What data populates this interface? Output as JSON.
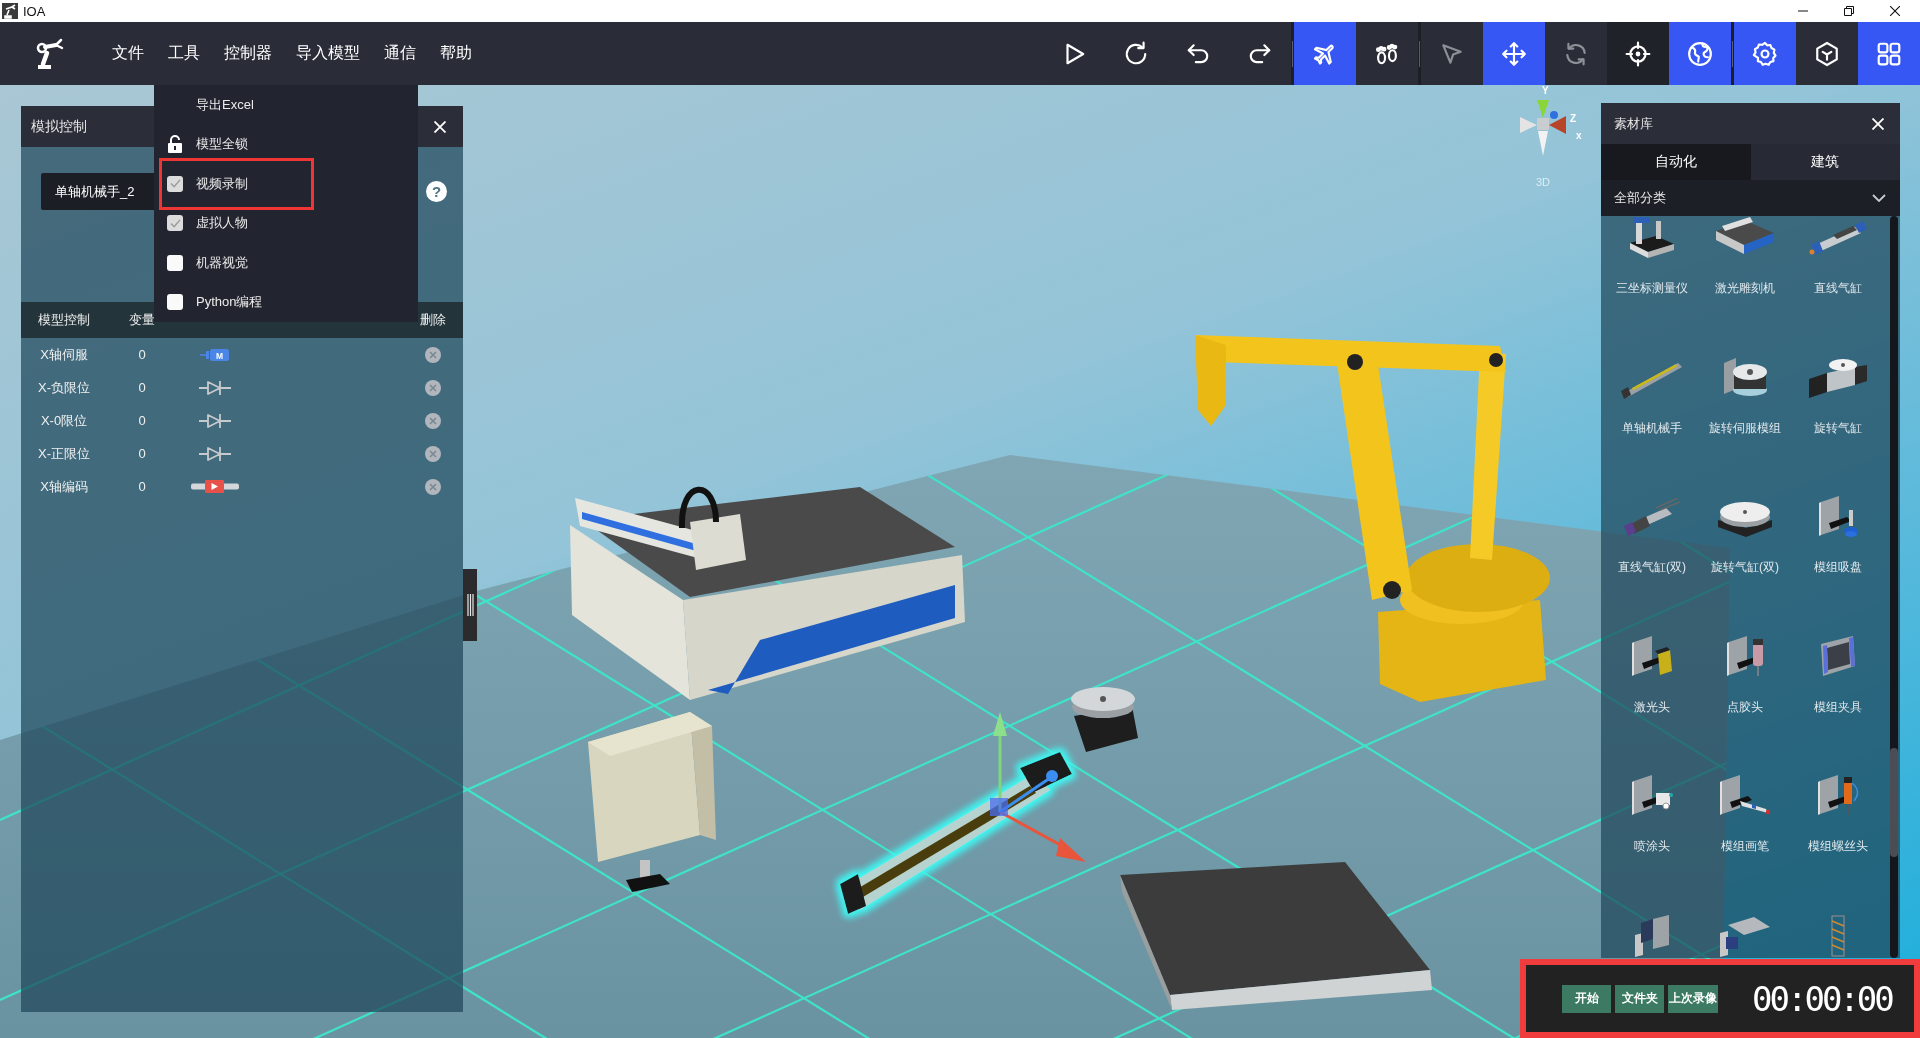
{
  "window": {
    "title": "IOA",
    "controls": [
      {
        "kind": "minimize"
      },
      {
        "kind": "restore"
      },
      {
        "kind": "close"
      }
    ]
  },
  "menu_bar": {
    "items": [
      {
        "label": "文件"
      },
      {
        "label": "工具",
        "dropdown": [
          {
            "kind": "plain",
            "label": "导出Excel",
            "highlighted": false
          },
          {
            "kind": "lock",
            "label": "模型全锁",
            "locked": false,
            "highlighted": false
          },
          {
            "kind": "checkbox",
            "label": "视频录制",
            "checked": true,
            "highlighted": true
          },
          {
            "kind": "checkbox",
            "label": "虚拟人物",
            "checked": true,
            "highlighted": false
          },
          {
            "kind": "checkbox",
            "label": "机器视觉",
            "checked": false,
            "highlighted": false
          },
          {
            "kind": "checkbox",
            "label": "Python编程",
            "checked": false,
            "highlighted": false
          }
        ]
      },
      {
        "label": "控制器"
      },
      {
        "label": "导入模型"
      },
      {
        "label": "通信"
      },
      {
        "label": "帮助"
      }
    ]
  },
  "toolbar": {
    "groups": [
      {
        "buttons": [
          {
            "kind": "play",
            "selected": false,
            "disabled": false,
            "hovered": false
          },
          {
            "kind": "refresh",
            "selected": false,
            "disabled": false,
            "hovered": false
          },
          {
            "kind": "undo",
            "selected": false,
            "disabled": false,
            "hovered": false
          },
          {
            "kind": "redo",
            "selected": false,
            "disabled": false,
            "hovered": false
          }
        ]
      },
      {
        "buttons": [
          {
            "kind": "airplane",
            "selected": true,
            "disabled": false,
            "hovered": false
          },
          {
            "kind": "footprints",
            "selected": false,
            "disabled": false,
            "hovered": false
          }
        ]
      },
      {
        "buttons": [
          {
            "kind": "cursor",
            "selected": false,
            "disabled": true,
            "hovered": false
          },
          {
            "kind": "move",
            "selected": true,
            "disabled": false,
            "hovered": false
          },
          {
            "kind": "sync",
            "selected": false,
            "disabled": true,
            "hovered": false
          },
          {
            "kind": "crosshair",
            "selected": false,
            "disabled": false,
            "hovered": true
          },
          {
            "kind": "globe",
            "selected": true,
            "disabled": false,
            "hovered": false
          }
        ]
      },
      {
        "buttons": [
          {
            "kind": "settings",
            "selected": true,
            "disabled": false,
            "hovered": false
          },
          {
            "kind": "cube",
            "selected": false,
            "disabled": false,
            "hovered": false
          },
          {
            "kind": "grid",
            "selected": true,
            "disabled": false,
            "hovered": false
          }
        ]
      }
    ]
  },
  "simulation_panel": {
    "title": "模拟控制",
    "model_select": {
      "value": "单轴机械手_2"
    },
    "help": "?",
    "columns": [
      {
        "kind": "name",
        "label": "模型控制"
      },
      {
        "kind": "value",
        "label": "变量"
      },
      {
        "kind": "delete",
        "label": "删除"
      }
    ],
    "rows": [
      {
        "name": "X轴伺服",
        "value": "0",
        "control": {
          "kind": "motor",
          "label": "M"
        }
      },
      {
        "name": "X-负限位",
        "value": "0",
        "control": {
          "kind": "limit-switch"
        }
      },
      {
        "name": "X-0限位",
        "value": "0",
        "control": {
          "kind": "limit-switch"
        }
      },
      {
        "name": "X-正限位",
        "value": "0",
        "control": {
          "kind": "limit-switch"
        }
      },
      {
        "name": "X轴编码",
        "value": "0",
        "control": {
          "kind": "encoder"
        }
      }
    ]
  },
  "library_panel": {
    "title": "素材库",
    "tabs": [
      {
        "label": "自动化",
        "selected": true
      },
      {
        "label": "建筑",
        "selected": false
      }
    ],
    "category": {
      "value": "全部分类"
    },
    "items": [
      {
        "kind": "cmm",
        "label": "三坐标测量仪"
      },
      {
        "kind": "engraver",
        "label": "激光雕刻机"
      },
      {
        "kind": "cylinder",
        "label": "直线气缸"
      },
      {
        "kind": "rail",
        "label": "单轴机械手"
      },
      {
        "kind": "rotary-servo",
        "label": "旋转伺服模组"
      },
      {
        "kind": "rotary-cylinder",
        "label": "旋转气缸"
      },
      {
        "kind": "twin-cylinder",
        "label": "直线气缸(双)"
      },
      {
        "kind": "rotary-table",
        "label": "旋转气缸(双)"
      },
      {
        "kind": "suction-cup",
        "label": "模组吸盘"
      },
      {
        "kind": "laser-head",
        "label": "激光头"
      },
      {
        "kind": "dispenser",
        "label": "点胶头"
      },
      {
        "kind": "gripper",
        "label": "模组夹具"
      },
      {
        "kind": "spray-head",
        "label": "喷涂头"
      },
      {
        "kind": "pen",
        "label": "模组画笔"
      },
      {
        "kind": "screwdriver",
        "label": "模组螺丝头"
      },
      {
        "kind": "side-clamp"
      },
      {
        "kind": "swing-plate"
      },
      {
        "kind": "tower"
      }
    ]
  },
  "viewport": {
    "gizmo": {
      "axes": [
        {
          "kind": "y",
          "label": "Y"
        },
        {
          "kind": "z",
          "label": "Z"
        },
        {
          "kind": "x",
          "label": "x"
        }
      ],
      "mode": "3D"
    },
    "objects": [
      {
        "kind": "engraving-machine",
        "selected": false
      },
      {
        "kind": "control-cabinet",
        "selected": false
      },
      {
        "kind": "robot-arm",
        "selected": false
      },
      {
        "kind": "rotary-table",
        "selected": false
      },
      {
        "kind": "linear-actuator",
        "selected": true
      },
      {
        "kind": "conveyor",
        "selected": false
      }
    ]
  },
  "recorder": {
    "highlighted": true,
    "buttons": [
      {
        "label": "开始"
      },
      {
        "label": "文件夹"
      },
      {
        "label": "上次录像"
      }
    ],
    "timer": "00:00:00"
  }
}
